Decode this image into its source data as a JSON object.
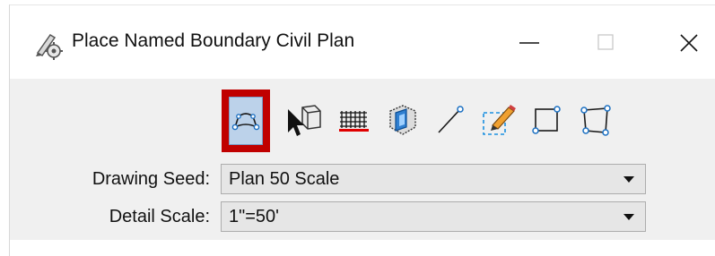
{
  "window": {
    "title": "Place Named Boundary Civil Plan",
    "icon": "gear-pencil-icon",
    "controls": [
      "minimize",
      "maximize",
      "close"
    ]
  },
  "toolbar": {
    "tools": [
      {
        "name": "civil-plan-tool",
        "icon": "civil-boundary-icon",
        "active": true
      },
      {
        "name": "select-element-tool",
        "icon": "cursor-cube-icon",
        "active": false
      },
      {
        "name": "grid-tool",
        "icon": "grid-red-icon",
        "active": false
      },
      {
        "name": "view-tool",
        "icon": "view-cube-icon",
        "active": false
      },
      {
        "name": "two-points-tool",
        "icon": "line-points-icon",
        "active": false
      },
      {
        "name": "from-element-tool",
        "icon": "pencil-dashed-icon",
        "active": false
      },
      {
        "name": "shape-tool",
        "icon": "square-points-icon",
        "active": false
      },
      {
        "name": "shape-skewed-tool",
        "icon": "skewed-square-points-icon",
        "active": false
      }
    ],
    "active_color": "#c00000"
  },
  "form": {
    "drawing_seed": {
      "label": "Drawing Seed:",
      "value": "Plan 50 Scale"
    },
    "detail_scale": {
      "label": "Detail Scale:",
      "value": "1\"=50'"
    }
  }
}
